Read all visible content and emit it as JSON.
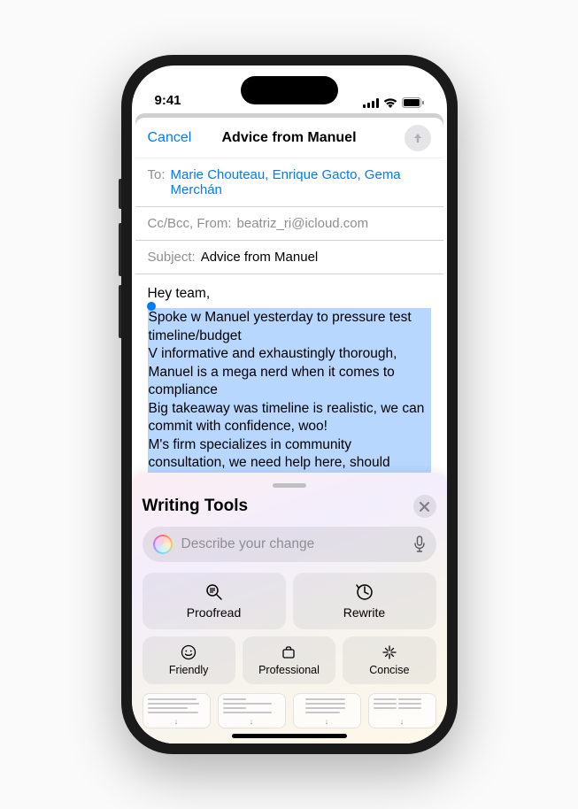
{
  "status_bar": {
    "time": "9:41"
  },
  "nav": {
    "cancel": "Cancel",
    "title": "Advice from Manuel"
  },
  "fields": {
    "to_label": "To:",
    "recipients": "Marie Chouteau, Enrique Gacto, Gema Merchán",
    "ccbcc_from": "Cc/Bcc, From:",
    "from_email": "beatriz_ri@icloud.com",
    "subject_label": "Subject:",
    "subject_value": "Advice from Manuel"
  },
  "body": {
    "greeting": "Hey team,",
    "selected": "Spoke w Manuel yesterday to pressure test timeline/budget\nV informative and exhaustingly thorough, Manuel is a mega nerd when it comes to compliance\nBig takeaway was timeline is realistic, we can commit with confidence, woo!\nM's firm specializes in community consultation, we need help here, should consider engaging"
  },
  "writing_tools": {
    "title": "Writing Tools",
    "placeholder": "Describe your change",
    "buttons": {
      "proofread": "Proofread",
      "rewrite": "Rewrite",
      "friendly": "Friendly",
      "professional": "Professional",
      "concise": "Concise"
    }
  }
}
